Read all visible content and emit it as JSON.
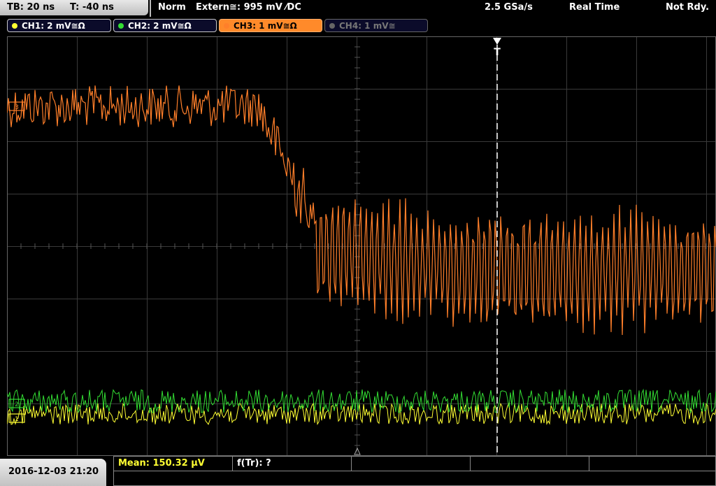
{
  "header": {
    "timebase": "TB: 20 ns",
    "trigger_time": "T: -40 ns",
    "mode": "Norm",
    "trigger_source": "Extern≅: 995 mV ⁄DC",
    "sample_rate": "2.5 GSa/s",
    "acquisition": "Real Time",
    "status": "Not Rdy."
  },
  "channels": [
    {
      "label": "CH1: 2 mV≅Ω",
      "color": "#ffff33",
      "state": "on"
    },
    {
      "label": "CH2: 2 mV≅Ω",
      "color": "#33dd33",
      "state": "on"
    },
    {
      "label": "CH3: 1 mV≅Ω",
      "color": "#ff7f2a",
      "state": "active"
    },
    {
      "label": "CH4: 1 mV≅",
      "color": "#777777",
      "state": "off"
    }
  ],
  "trigger_marker": "T",
  "footer": {
    "datetime": "2016-12-03 21:20",
    "meas1": "Mean: 150.32 µV",
    "meas2": "f(Tr): ?"
  },
  "colors": {
    "grid": "#3a3a3a",
    "ch1": "#ffff33",
    "ch2": "#33dd33",
    "ch3": "#ff7f2a",
    "trigger_line": "#ffffff"
  }
}
